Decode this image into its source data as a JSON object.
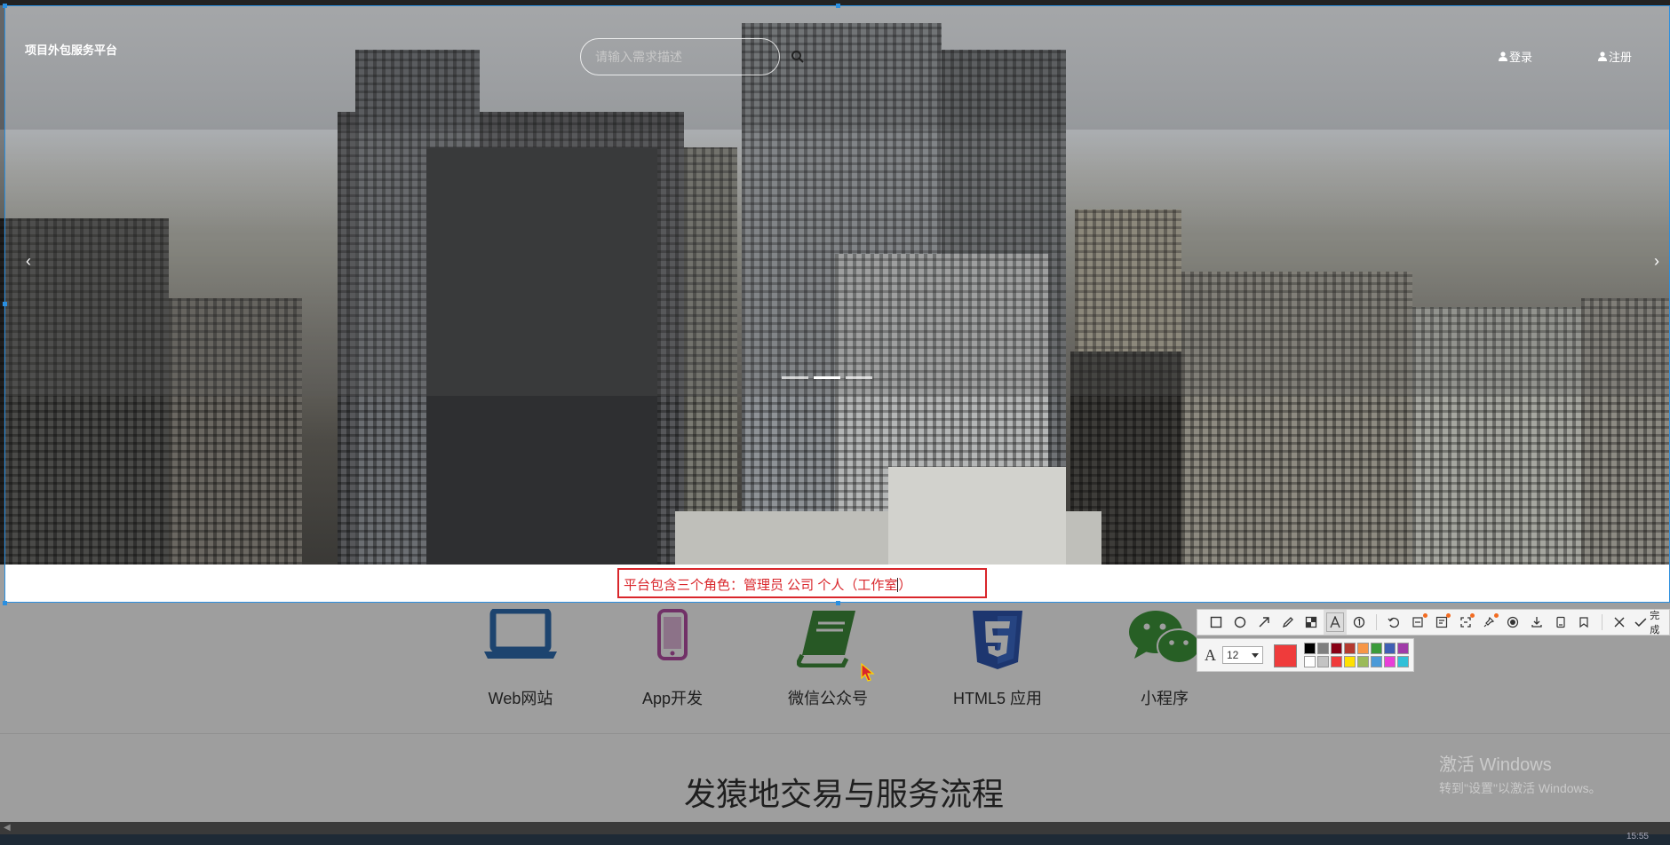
{
  "site": {
    "title": "项目外包服务平台",
    "search_placeholder": "请输入需求描述",
    "login_label": "登录",
    "register_label": "注册"
  },
  "carousel": {
    "prev_arrow": "‹",
    "next_arrow": "›",
    "slide_count": 3,
    "active_slide": 2
  },
  "services": [
    {
      "label": "Web网站",
      "icon": "laptop-icon",
      "color": "#2f6fb4"
    },
    {
      "label": "App开发",
      "icon": "mobile-phone-icon",
      "color": "#b64fa6"
    },
    {
      "label": "微信公众号",
      "icon": "book-icon",
      "color": "#3f8f3c"
    },
    {
      "label": "HTML5 应用",
      "icon": "html5-icon",
      "color": "#2f58b4"
    },
    {
      "label": "小程序",
      "icon": "wechat-icon",
      "color": "#3f9a3c"
    }
  ],
  "section": {
    "title": "发猿地交易与服务流程"
  },
  "annotation": {
    "text": "平台包含三个角色：管理员  公司  个人（工作室",
    "color": "#d9262b"
  },
  "snip_toolbar": {
    "tools": [
      "rectangle-icon",
      "ellipse-icon",
      "arrow-icon",
      "pencil-icon",
      "mosaic-icon",
      "text-icon",
      "number-icon",
      "undo-icon",
      "redo-icon",
      "ocr-icon",
      "scroll-icon",
      "pin-icon",
      "record-icon",
      "download-icon",
      "save-icon",
      "bookmark-icon",
      "close-icon",
      "check-icon"
    ],
    "active_tool": "text-icon",
    "done_label": "完成",
    "font_icon": "A",
    "font_size": "12",
    "current_color": "#ef3b3b",
    "palette": [
      "#000000",
      "#7f7f7f",
      "#880015",
      "#b5392f",
      "#f79646",
      "#3b9b3b",
      "#3f5fb4",
      "#a03ca8",
      "#ffffff",
      "#c3c3c3",
      "#ef3b3b",
      "#ffe000",
      "#9bbb59",
      "#4b9ad8",
      "#e83fd8",
      "#31c0d8"
    ]
  },
  "watermark": {
    "line1": "激活 Windows",
    "line2": "转到\"设置\"以激活 Windows。"
  },
  "taskbar": {
    "clock": "15:55"
  }
}
